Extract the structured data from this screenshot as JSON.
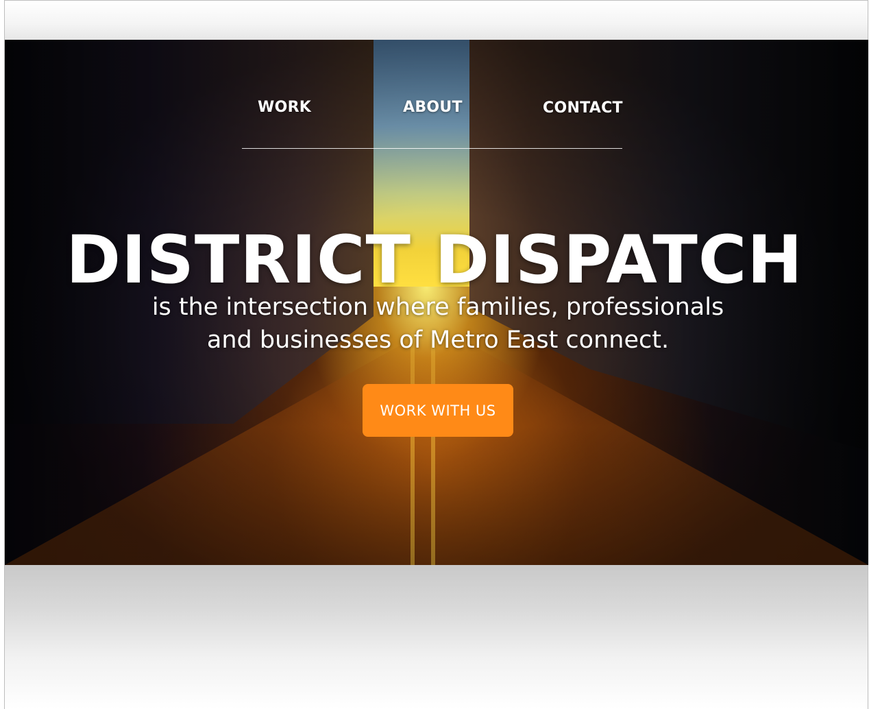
{
  "nav": {
    "items": [
      {
        "label": "WORK"
      },
      {
        "label": "ABOUT"
      },
      {
        "label": "CONTACT"
      }
    ]
  },
  "hero": {
    "title": "DISTRICT DISPATCH",
    "tagline": "is the intersection where families, professionals and businesses of Metro East connect.",
    "cta_label": "WORK WITH US",
    "background": "city-street-sunset-photo"
  },
  "colors": {
    "accent": "#ff8a17",
    "text": "#ffffff"
  }
}
